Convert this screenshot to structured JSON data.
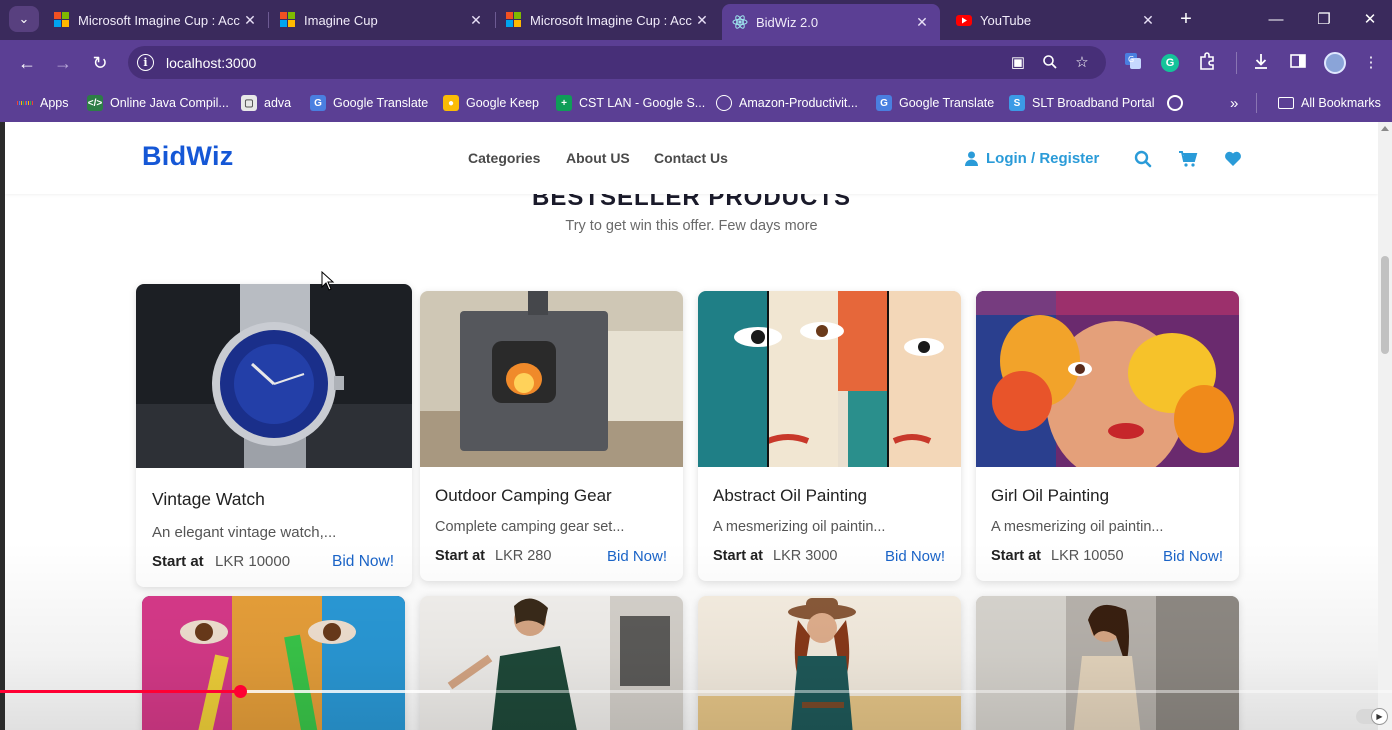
{
  "browser": {
    "tabs": [
      {
        "title": "Microsoft Imagine Cup : Acc",
        "favicon": "microsoft-logo",
        "active": false
      },
      {
        "title": "Imagine Cup",
        "favicon": "microsoft-logo",
        "active": false
      },
      {
        "title": "Microsoft Imagine Cup : Acc",
        "favicon": "microsoft-logo",
        "active": false
      },
      {
        "title": "BidWiz 2.0",
        "favicon": "react-logo",
        "active": true
      },
      {
        "title": "YouTube",
        "favicon": "youtube-logo",
        "active": false
      }
    ],
    "address": "localhost:3000",
    "bookmarks": [
      {
        "label": "Apps",
        "icon": "apps-grid-icon"
      },
      {
        "label": "Online Java Compil...",
        "icon": "java-icon"
      },
      {
        "label": "adva",
        "icon": "page-icon"
      },
      {
        "label": "Google Translate",
        "icon": "translate-icon"
      },
      {
        "label": "Google Keep",
        "icon": "keep-icon"
      },
      {
        "label": "CST LAN - Google S...",
        "icon": "sheets-icon"
      },
      {
        "label": "Amazon-Productivit...",
        "icon": "globe-icon"
      },
      {
        "label": "Google Translate",
        "icon": "translate-icon"
      },
      {
        "label": "SLT Broadband Portal",
        "icon": "slt-icon"
      }
    ],
    "all_bookmarks": "All Bookmarks",
    "colors": {
      "chrome_dark": "#3a2a5c",
      "chrome": "#5b3f94"
    }
  },
  "site": {
    "brand": "BidWiz",
    "nav": [
      "Categories",
      "About US",
      "Contact Us"
    ],
    "login": "Login / Register",
    "colors": {
      "brand": "#1557d6",
      "accent": "#2a9bd8",
      "bid": "#1a64c8"
    }
  },
  "section": {
    "heading": "BESTSELLER PRODUCTS",
    "subtitle": "Try to get win this offer. Few days more"
  },
  "products": [
    {
      "title": "Vintage Watch",
      "desc": "An elegant vintage watch,...",
      "start_label": "Start at",
      "price": "LKR 10000",
      "bid": "Bid Now!",
      "image": "wristwatch-photo"
    },
    {
      "title": "Outdoor Camping Gear",
      "desc": "Complete camping gear set...",
      "start_label": "Start at",
      "price": "LKR 280",
      "bid": "Bid Now!",
      "image": "wood-stove-photo"
    },
    {
      "title": "Abstract Oil Painting",
      "desc": "A mesmerizing oil paintin...",
      "start_label": "Start at",
      "price": "LKR 3000",
      "bid": "Bid Now!",
      "image": "cubist-faces-painting"
    },
    {
      "title": "Girl Oil Painting",
      "desc": "A mesmerizing oil paintin...",
      "start_label": "Start at",
      "price": "LKR 10050",
      "bid": "Bid Now!",
      "image": "butterfly-woman-painting"
    }
  ],
  "second_row_images": [
    "painted-face-photo",
    "green-dress-photo",
    "hat-woman-photo",
    "gown-woman-photo"
  ],
  "video": {
    "played_fraction": 0.17
  }
}
